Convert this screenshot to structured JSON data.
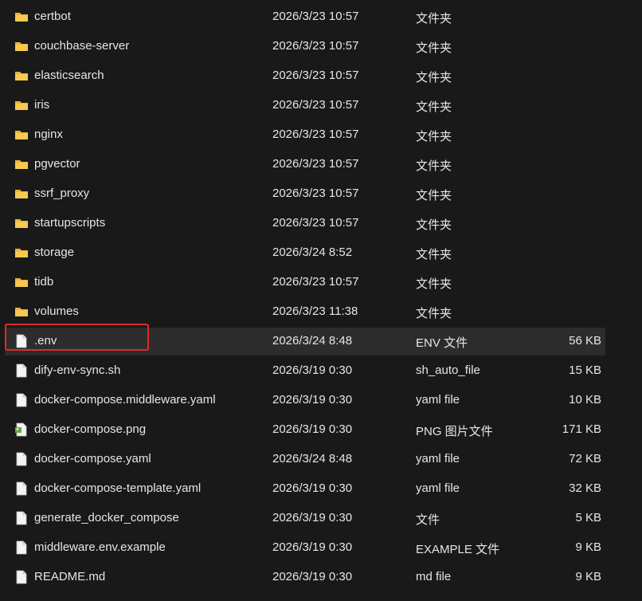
{
  "colors": {
    "background": "#191919",
    "text": "#e6e6e6",
    "folder": "#f3c24a",
    "selected_row": "#2c2c2c",
    "highlight_box": "#e02a2a"
  },
  "files": [
    {
      "name": "certbot",
      "date": "2026/3/23 10:57",
      "type": "文件夹",
      "size": "",
      "icon": "folder-icon"
    },
    {
      "name": "couchbase-server",
      "date": "2026/3/23 10:57",
      "type": "文件夹",
      "size": "",
      "icon": "folder-icon"
    },
    {
      "name": "elasticsearch",
      "date": "2026/3/23 10:57",
      "type": "文件夹",
      "size": "",
      "icon": "folder-icon"
    },
    {
      "name": "iris",
      "date": "2026/3/23 10:57",
      "type": "文件夹",
      "size": "",
      "icon": "folder-icon"
    },
    {
      "name": "nginx",
      "date": "2026/3/23 10:57",
      "type": "文件夹",
      "size": "",
      "icon": "folder-icon"
    },
    {
      "name": "pgvector",
      "date": "2026/3/23 10:57",
      "type": "文件夹",
      "size": "",
      "icon": "folder-icon"
    },
    {
      "name": "ssrf_proxy",
      "date": "2026/3/23 10:57",
      "type": "文件夹",
      "size": "",
      "icon": "folder-icon"
    },
    {
      "name": "startupscripts",
      "date": "2026/3/23 10:57",
      "type": "文件夹",
      "size": "",
      "icon": "folder-icon"
    },
    {
      "name": "storage",
      "date": "2026/3/24 8:52",
      "type": "文件夹",
      "size": "",
      "icon": "folder-icon"
    },
    {
      "name": "tidb",
      "date": "2026/3/23 10:57",
      "type": "文件夹",
      "size": "",
      "icon": "folder-icon"
    },
    {
      "name": "volumes",
      "date": "2026/3/23 11:38",
      "type": "文件夹",
      "size": "",
      "icon": "folder-icon"
    },
    {
      "name": ".env",
      "date": "2026/3/24 8:48",
      "type": "ENV 文件",
      "size": "56 KB",
      "icon": "file-icon",
      "selected": true
    },
    {
      "name": "dify-env-sync.sh",
      "date": "2026/3/19 0:30",
      "type": "sh_auto_file",
      "size": "15 KB",
      "icon": "file-icon"
    },
    {
      "name": "docker-compose.middleware.yaml",
      "date": "2026/3/19 0:30",
      "type": "yaml file",
      "size": "10 KB",
      "icon": "file-icon"
    },
    {
      "name": "docker-compose.png",
      "date": "2026/3/19 0:30",
      "type": "PNG 图片文件",
      "size": "171 KB",
      "icon": "image-file-icon"
    },
    {
      "name": "docker-compose.yaml",
      "date": "2026/3/24 8:48",
      "type": "yaml file",
      "size": "72 KB",
      "icon": "file-icon"
    },
    {
      "name": "docker-compose-template.yaml",
      "date": "2026/3/19 0:30",
      "type": "yaml file",
      "size": "32 KB",
      "icon": "file-icon"
    },
    {
      "name": "generate_docker_compose",
      "date": "2026/3/19 0:30",
      "type": "文件",
      "size": "5 KB",
      "icon": "file-icon"
    },
    {
      "name": "middleware.env.example",
      "date": "2026/3/19 0:30",
      "type": "EXAMPLE 文件",
      "size": "9 KB",
      "icon": "file-icon"
    },
    {
      "name": "README.md",
      "date": "2026/3/19 0:30",
      "type": "md file",
      "size": "9 KB",
      "icon": "file-icon"
    }
  ]
}
